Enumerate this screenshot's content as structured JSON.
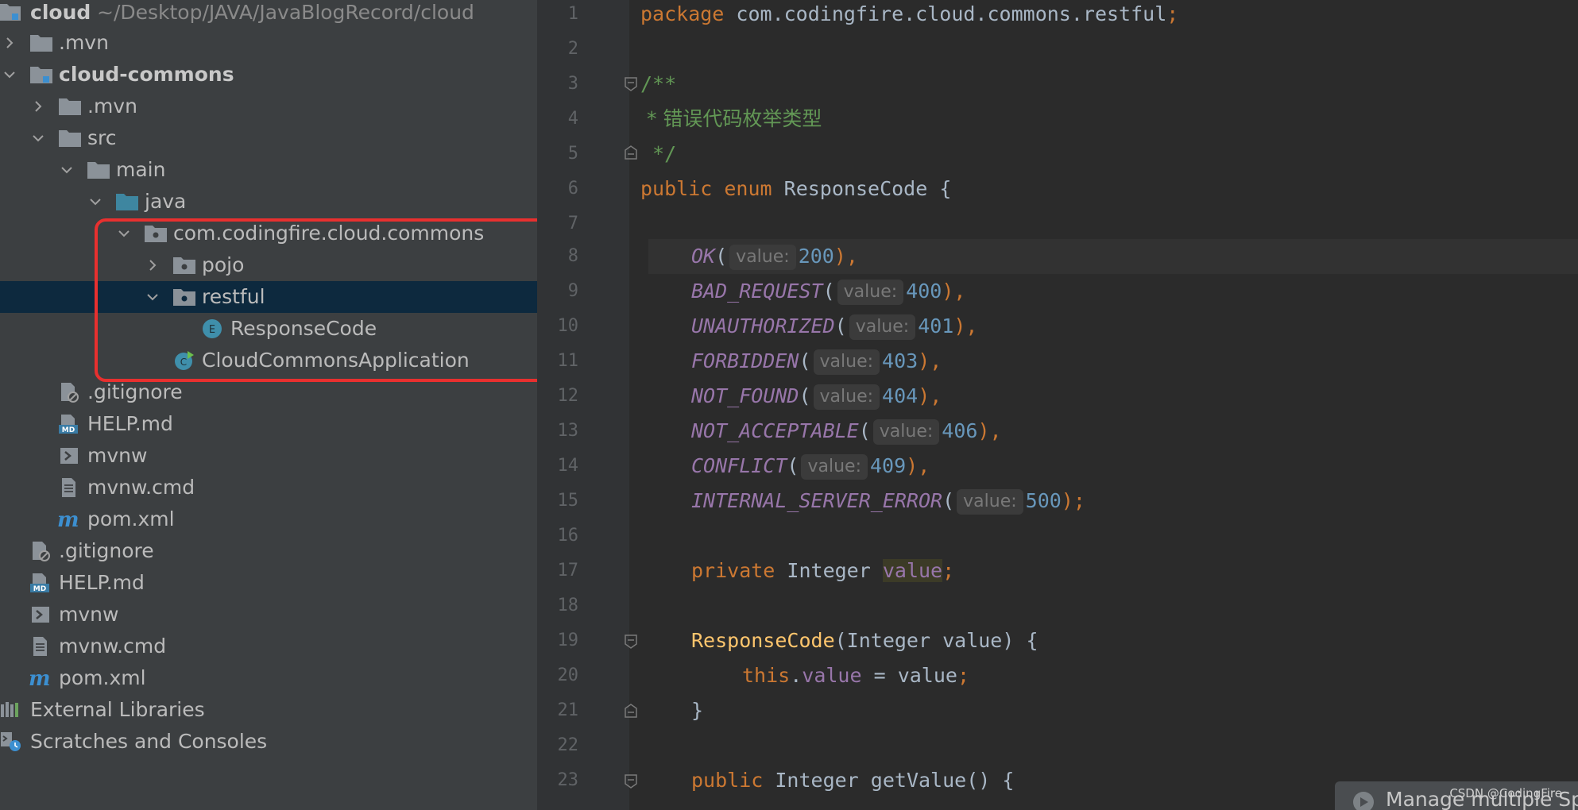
{
  "project_tree": {
    "root": {
      "label": "cloud",
      "path": "~/Desktop/JAVA/JavaBlogRecord/cloud"
    },
    "items": [
      {
        "label": ".mvn"
      },
      {
        "label": "cloud-commons"
      },
      {
        "label": ".mvn"
      },
      {
        "label": "src"
      },
      {
        "label": "main"
      },
      {
        "label": "java"
      },
      {
        "label": "com.codingfire.cloud.commons"
      },
      {
        "label": "pojo"
      },
      {
        "label": "restful"
      },
      {
        "label": "ResponseCode"
      },
      {
        "label": "CloudCommonsApplication"
      },
      {
        "label": ".gitignore"
      },
      {
        "label": "HELP.md"
      },
      {
        "label": "mvnw"
      },
      {
        "label": "mvnw.cmd"
      },
      {
        "label": "pom.xml"
      },
      {
        "label": ".gitignore"
      },
      {
        "label": "HELP.md"
      },
      {
        "label": "mvnw"
      },
      {
        "label": "mvnw.cmd"
      },
      {
        "label": "pom.xml"
      },
      {
        "label": "External Libraries"
      },
      {
        "label": "Scratches and Consoles"
      }
    ],
    "selected": "restful"
  },
  "editor": {
    "line_numbers": [
      "1",
      "2",
      "3",
      "4",
      "5",
      "6",
      "7",
      "8",
      "9",
      "10",
      "11",
      "12",
      "13",
      "14",
      "15",
      "16",
      "17",
      "18",
      "19",
      "20",
      "21",
      "22",
      "23"
    ],
    "package_kw": "package",
    "package_name": " com.codingfire.cloud.commons.restful",
    "semicolon": ";",
    "comment_open": "/**",
    "comment_text": " * 错误代码枚举类型",
    "comment_close": " */",
    "kw_public": "public",
    "kw_enum": "enum",
    "kw_private": "private",
    "kw_this": "this",
    "enum_name": "ResponseCode",
    "open_brace": "{",
    "hint_label": "value:",
    "constants": [
      {
        "name": "OK",
        "value": "200",
        "end": "),"
      },
      {
        "name": "BAD_REQUEST",
        "value": "400",
        "end": "),"
      },
      {
        "name": "UNAUTHORIZED",
        "value": "401",
        "end": "),"
      },
      {
        "name": "FORBIDDEN",
        "value": "403",
        "end": "),"
      },
      {
        "name": "NOT_FOUND",
        "value": "404",
        "end": "),"
      },
      {
        "name": "NOT_ACCEPTABLE",
        "value": "406",
        "end": "),"
      },
      {
        "name": "CONFLICT",
        "value": "409",
        "end": "),"
      },
      {
        "name": "INTERNAL_SERVER_ERROR",
        "value": "500",
        "end": ");"
      }
    ],
    "type_integer": "Integer",
    "field_value": "value",
    "constructor_params": "(Integer value) {",
    "assign_dot": ".",
    "assign_rest": " = value",
    "close_brace": "}",
    "getter_name": "getValue",
    "getter_rest": "() {"
  },
  "notification": {
    "text": "Manage multiple Sp"
  },
  "watermark": "CSDN @CodingFire"
}
